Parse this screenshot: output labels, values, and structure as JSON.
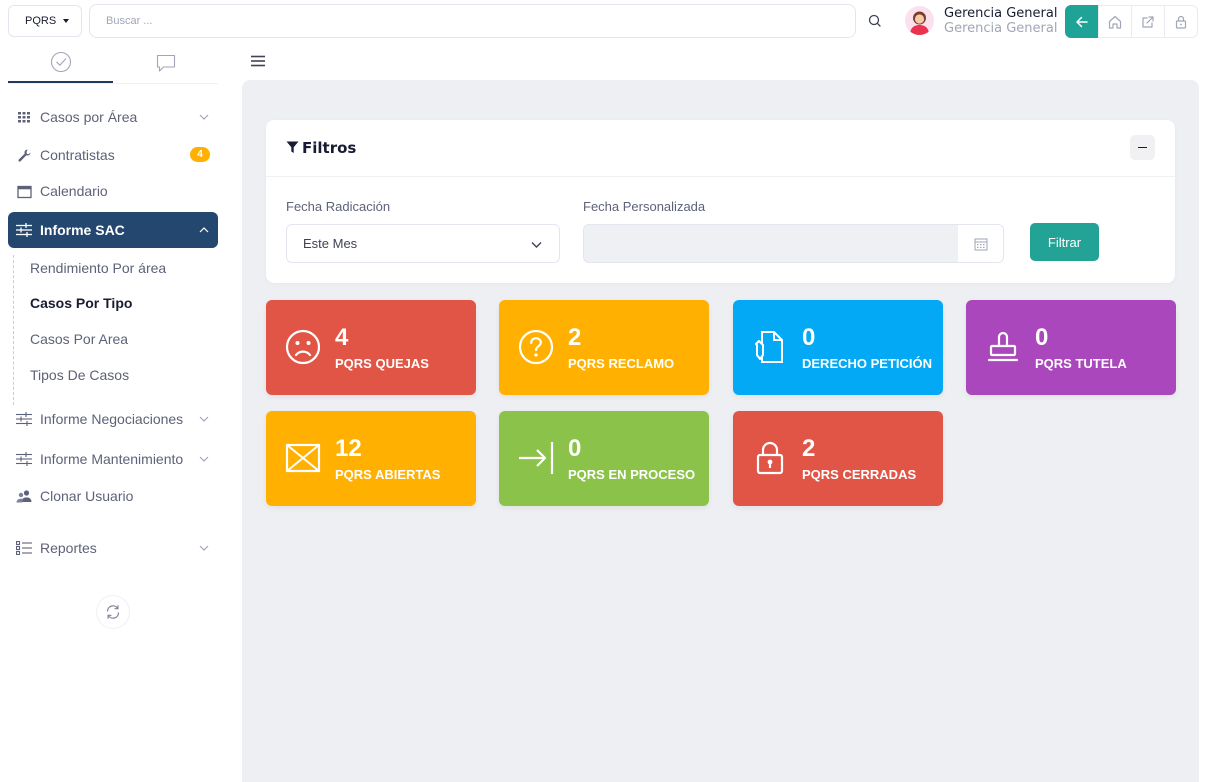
{
  "topbar": {
    "module_label": "PQRS",
    "search_placeholder": "Buscar ...",
    "user_name": "Gerencia General",
    "user_role": "Gerencia General"
  },
  "sidebar": {
    "items": [
      {
        "label": "Casos por Área",
        "icon": "grid-icon"
      },
      {
        "label": "Contratistas",
        "icon": "wrench-icon",
        "badge": "4"
      },
      {
        "label": "Calendario",
        "icon": "calendar-icon"
      },
      {
        "label": "Informe SAC",
        "icon": "sliders-icon"
      },
      {
        "label": "Informe Negociaciones",
        "icon": "sliders-icon"
      },
      {
        "label": "Informe Mantenimiento",
        "icon": "sliders-icon"
      },
      {
        "label": "Clonar Usuario",
        "icon": "users-icon"
      },
      {
        "label": "Reportes",
        "icon": "list-icon"
      }
    ],
    "submenu": [
      {
        "label": "Rendimiento Por área"
      },
      {
        "label": "Casos Por Tipo"
      },
      {
        "label": "Casos Por Area"
      },
      {
        "label": "Tipos De Casos"
      }
    ]
  },
  "filters": {
    "title": "Filtros",
    "fecha_radicacion_label": "Fecha Radicación",
    "fecha_radicacion_value": "Este Mes",
    "fecha_personalizada_label": "Fecha Personalizada",
    "fecha_personalizada_value": "",
    "filter_button": "Filtrar"
  },
  "tiles": [
    {
      "count": "4",
      "label": "PQRS QUEJAS",
      "color": "#e05546",
      "icon": "sad-face-icon"
    },
    {
      "count": "2",
      "label": "PQRS RECLAMO",
      "color": "#ffb000",
      "icon": "question-circle-icon"
    },
    {
      "count": "0",
      "label": "DERECHO PETICIÓN",
      "color": "#03a9f4",
      "icon": "document-pen-icon"
    },
    {
      "count": "0",
      "label": "PQRS TUTELA",
      "color": "#ab47bc",
      "icon": "stamp-icon"
    },
    {
      "count": "12",
      "label": "PQRS ABIERTAS",
      "color": "#ffb000",
      "icon": "envelope-icon"
    },
    {
      "count": "0",
      "label": "PQRS EN PROCESO",
      "color": "#8bc34a",
      "icon": "arrow-in-icon"
    },
    {
      "count": "2",
      "label": "PQRS CERRADAS",
      "color": "#e05546",
      "icon": "lock-icon"
    }
  ]
}
